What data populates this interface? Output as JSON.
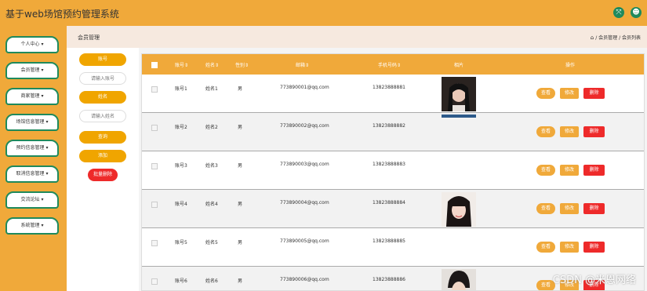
{
  "app": {
    "title": "基于web场馆预约管理系统"
  },
  "header_icons": [
    {
      "icon": "expand-icon",
      "glyph": "⤧"
    },
    {
      "icon": "user-icon",
      "glyph": "☻"
    }
  ],
  "sidebar": {
    "items": [
      {
        "label": "个人中心 ▾"
      },
      {
        "label": "会员管理 ▾"
      },
      {
        "label": "商家管理 ▾"
      },
      {
        "label": "场馆信息管理 ▾"
      },
      {
        "label": "预约信息管理 ▾"
      },
      {
        "label": "取消信息管理 ▾"
      },
      {
        "label": "交流论坛 ▾"
      },
      {
        "label": "系统管理 ▾"
      }
    ]
  },
  "breadcrumb": {
    "title": "会员管理",
    "home_glyph": "⌂",
    "path": "/ 会员管理 / 会员列表"
  },
  "search": {
    "account_label": "账号",
    "account_placeholder": "请输入账号",
    "name_label": "姓名",
    "name_placeholder": "请输入姓名",
    "query_button": "查询",
    "add_button": "添加",
    "batch_delete_button": "批量删除"
  },
  "table": {
    "headers": {
      "account": "账号⇕",
      "name": "姓名⇕",
      "gender": "性别⇕",
      "email": "邮箱⇕",
      "phone": "手机号码⇕",
      "photo": "相片",
      "actions": "操作"
    },
    "action_labels": {
      "view": "查看",
      "edit": "修改",
      "delete": "删除"
    },
    "rows": [
      {
        "account": "账号1",
        "name": "姓名1",
        "gender": "男",
        "email": "773890001@qq.com",
        "phone": "13823888881",
        "photo": "girl-dark-hair"
      },
      {
        "account": "账号2",
        "name": "姓名2",
        "gender": "男",
        "email": "773890002@qq.com",
        "phone": "13823888882",
        "photo": "cropped-photo"
      },
      {
        "account": "账号3",
        "name": "姓名3",
        "gender": "男",
        "email": "773890003@qq.com",
        "phone": "13823888883",
        "photo": "none"
      },
      {
        "account": "账号4",
        "name": "姓名4",
        "gender": "男",
        "email": "773890004@qq.com",
        "phone": "13823888884",
        "photo": "girl-bangs"
      },
      {
        "account": "账号5",
        "name": "姓名5",
        "gender": "男",
        "email": "773890005@qq.com",
        "phone": "13823888885",
        "photo": "none"
      },
      {
        "account": "账号6",
        "name": "姓名6",
        "gender": "男",
        "email": "773890006@qq.com",
        "phone": "13823888886",
        "photo": "boy-dark-hair"
      }
    ]
  },
  "watermark": "CSDN @米恩网络",
  "colors": {
    "header": "#f0a93a",
    "accent_green": "#1f8a5c",
    "delete_red": "#ee2a2a",
    "button_orange": "#f0a500"
  }
}
